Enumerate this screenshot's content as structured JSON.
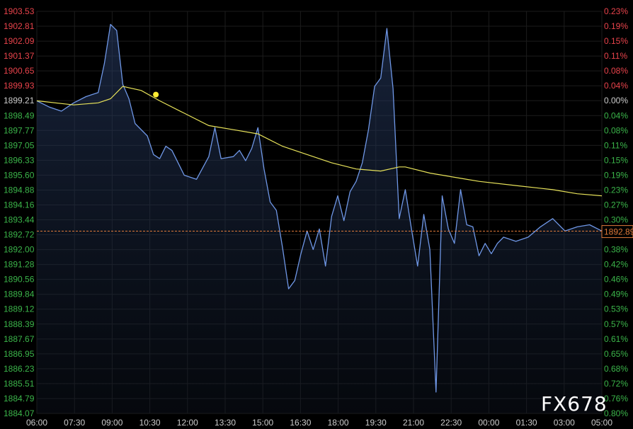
{
  "watermark": "FX678",
  "current_price_label": "1892.89",
  "colors": {
    "background": "#000000",
    "price_line": "#6f97e6",
    "avg_line": "#e8e35a",
    "grid": "#1c1c1c",
    "up": "#e8434b",
    "down": "#3bb54a",
    "current": "#e07a3a",
    "axis_text": "#cccccc"
  },
  "chart_data": {
    "type": "area",
    "title": "",
    "xlabel": "",
    "ylabel": "",
    "ylim": [
      1884.07,
      1903.53
    ],
    "reference_price": 1899.21,
    "current_price": 1892.89,
    "left_ticks": [
      "1903.53",
      "1902.81",
      "1902.09",
      "1901.37",
      "1900.65",
      "1899.93",
      "1899.21",
      "1898.49",
      "1897.77",
      "1897.05",
      "1896.33",
      "1895.60",
      "1894.88",
      "1894.16",
      "1893.44",
      "1892.72",
      "1892.00",
      "1891.28",
      "1890.56",
      "1889.84",
      "1889.12",
      "1888.39",
      "1887.67",
      "1886.95",
      "1886.23",
      "1885.51",
      "1884.79",
      "1884.07"
    ],
    "right_ticks": [
      "0.23%",
      "0.19%",
      "0.15%",
      "0.11%",
      "0.08%",
      "0.04%",
      "0.00%",
      "0.04%",
      "0.08%",
      "0.11%",
      "0.15%",
      "0.19%",
      "0.23%",
      "0.27%",
      "0.30%",
      "0.34%",
      "0.38%",
      "0.42%",
      "0.46%",
      "0.49%",
      "0.53%",
      "0.57%",
      "0.61%",
      "0.65%",
      "0.68%",
      "0.72%",
      "0.76%",
      "0.80%"
    ],
    "x_ticks": [
      "06:00",
      "07:30",
      "09:00",
      "10:30",
      "12:00",
      "13:30",
      "15:00",
      "16:30",
      "18:00",
      "19:30",
      "21:00",
      "22:30",
      "00:00",
      "01:30",
      "03:00",
      "05:00"
    ],
    "grid": true,
    "series": [
      {
        "x": [
          "06:00",
          "06:30",
          "07:00",
          "07:30",
          "08:00",
          "08:30",
          "08:45",
          "09:00",
          "09:15",
          "09:30",
          "09:45",
          "10:00",
          "10:30",
          "10:45",
          "11:00",
          "11:15",
          "11:30",
          "12:00",
          "12:30",
          "13:00",
          "13:15",
          "13:30",
          "14:00",
          "14:15",
          "14:30",
          "14:45",
          "15:00",
          "15:15",
          "15:30",
          "15:45",
          "16:00",
          "16:15",
          "16:30",
          "16:45",
          "17:00",
          "17:15",
          "17:30",
          "17:45",
          "18:00",
          "18:15",
          "18:30",
          "18:45",
          "19:00",
          "19:15",
          "19:30",
          "19:45",
          "20:00",
          "20:15",
          "20:30",
          "20:45",
          "21:00",
          "21:15",
          "21:30",
          "21:45",
          "22:00",
          "22:15",
          "22:30",
          "22:45",
          "23:00",
          "23:15",
          "23:30",
          "23:45",
          "00:00",
          "00:15",
          "00:30",
          "00:45",
          "01:00",
          "01:30",
          "02:00",
          "02:30",
          "03:00",
          "03:30",
          "04:00",
          "04:30",
          "05:00"
        ],
        "values": [
          1899.2,
          1898.9,
          1898.7,
          1899.1,
          1899.4,
          1899.6,
          1901.0,
          1902.9,
          1902.6,
          1900.0,
          1899.3,
          1898.1,
          1897.5,
          1896.6,
          1896.4,
          1897.0,
          1896.8,
          1895.6,
          1895.4,
          1896.5,
          1897.9,
          1896.4,
          1896.5,
          1896.8,
          1896.3,
          1896.9,
          1897.9,
          1895.9,
          1894.3,
          1893.9,
          1892.1,
          1890.1,
          1890.5,
          1891.8,
          1892.9,
          1892.0,
          1893.0,
          1891.2,
          1893.6,
          1894.6,
          1893.4,
          1894.8,
          1895.3,
          1896.2,
          1897.8,
          1899.9,
          1900.3,
          1902.7,
          1899.8,
          1893.5,
          1894.9,
          1893.0,
          1891.2,
          1893.7,
          1892.0,
          1885.1,
          1894.6,
          1893.0,
          1892.3,
          1894.9,
          1893.2,
          1893.1,
          1891.7,
          1892.3,
          1891.8,
          1892.3,
          1892.6,
          1892.4,
          1892.6,
          1893.1,
          1893.5,
          1892.9,
          1893.1,
          1893.2,
          1892.9
        ]
      },
      {
        "name": "",
        "x": [
          "06:00",
          "07:30",
          "08:30",
          "09:00",
          "09:30",
          "10:15",
          "11:00",
          "12:00",
          "13:00",
          "14:00",
          "15:00",
          "16:00",
          "17:00",
          "18:00",
          "19:00",
          "20:00",
          "20:45",
          "21:00",
          "22:00",
          "23:00",
          "00:00",
          "01:30",
          "03:00",
          "04:00",
          "05:00"
        ],
        "values": [
          1899.2,
          1899.0,
          1899.1,
          1899.3,
          1899.9,
          1899.7,
          1899.2,
          1898.6,
          1898.0,
          1897.8,
          1897.6,
          1897.0,
          1896.6,
          1896.2,
          1895.9,
          1895.8,
          1896.0,
          1896.0,
          1895.7,
          1895.5,
          1895.3,
          1895.1,
          1894.9,
          1894.7,
          1894.6
        ]
      }
    ],
    "highlight_point": {
      "x": "10:30",
      "y": 1899.5
    }
  }
}
